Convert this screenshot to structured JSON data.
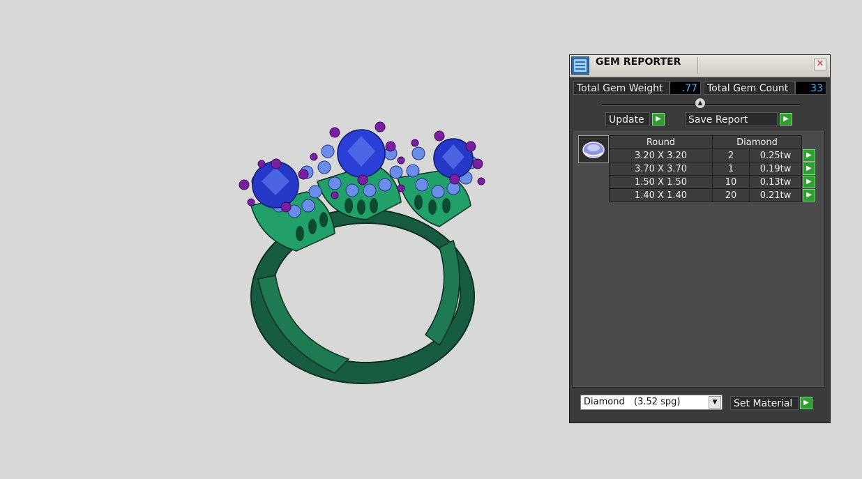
{
  "panel": {
    "title": "GEM REPORTER",
    "close_symbol": "✕",
    "total_weight_label": "Total Gem Weight",
    "total_weight_value": ".77",
    "total_count_label": "Total Gem Count",
    "total_count_value": "33",
    "update_label": "Update",
    "save_report_label": "Save Report",
    "table": {
      "header_shape": "Round",
      "header_type": "Diamond",
      "rows": [
        {
          "size": "3.20 X 3.20",
          "count": "2",
          "weight": "0.25tw"
        },
        {
          "size": "3.70 X 3.70",
          "count": "1",
          "weight": "0.19tw"
        },
        {
          "size": "1.50 X 1.50",
          "count": "10",
          "weight": "0.13tw"
        },
        {
          "size": "1.40 X 1.40",
          "count": "20",
          "weight": "0.21tw"
        }
      ]
    },
    "material_name": "Diamond",
    "material_spg": "(3.52 spg)",
    "set_material_label": "Set Material",
    "go_symbol": "▶"
  },
  "colors": {
    "background": "#d8d8d8",
    "metal": "#1f8a5a",
    "center_stone": "#2538c8",
    "halo_stone": "#6a8de8",
    "prongs": "#7a1fa3",
    "panel": "#3b3b3b",
    "value_text": "#3ab2ff",
    "go_button": "#2fa02f"
  },
  "icons": [
    "app-icon",
    "close-icon",
    "slider-knob-icon",
    "play-icon",
    "gem-thumbnail",
    "dropdown-arrow-icon"
  ]
}
